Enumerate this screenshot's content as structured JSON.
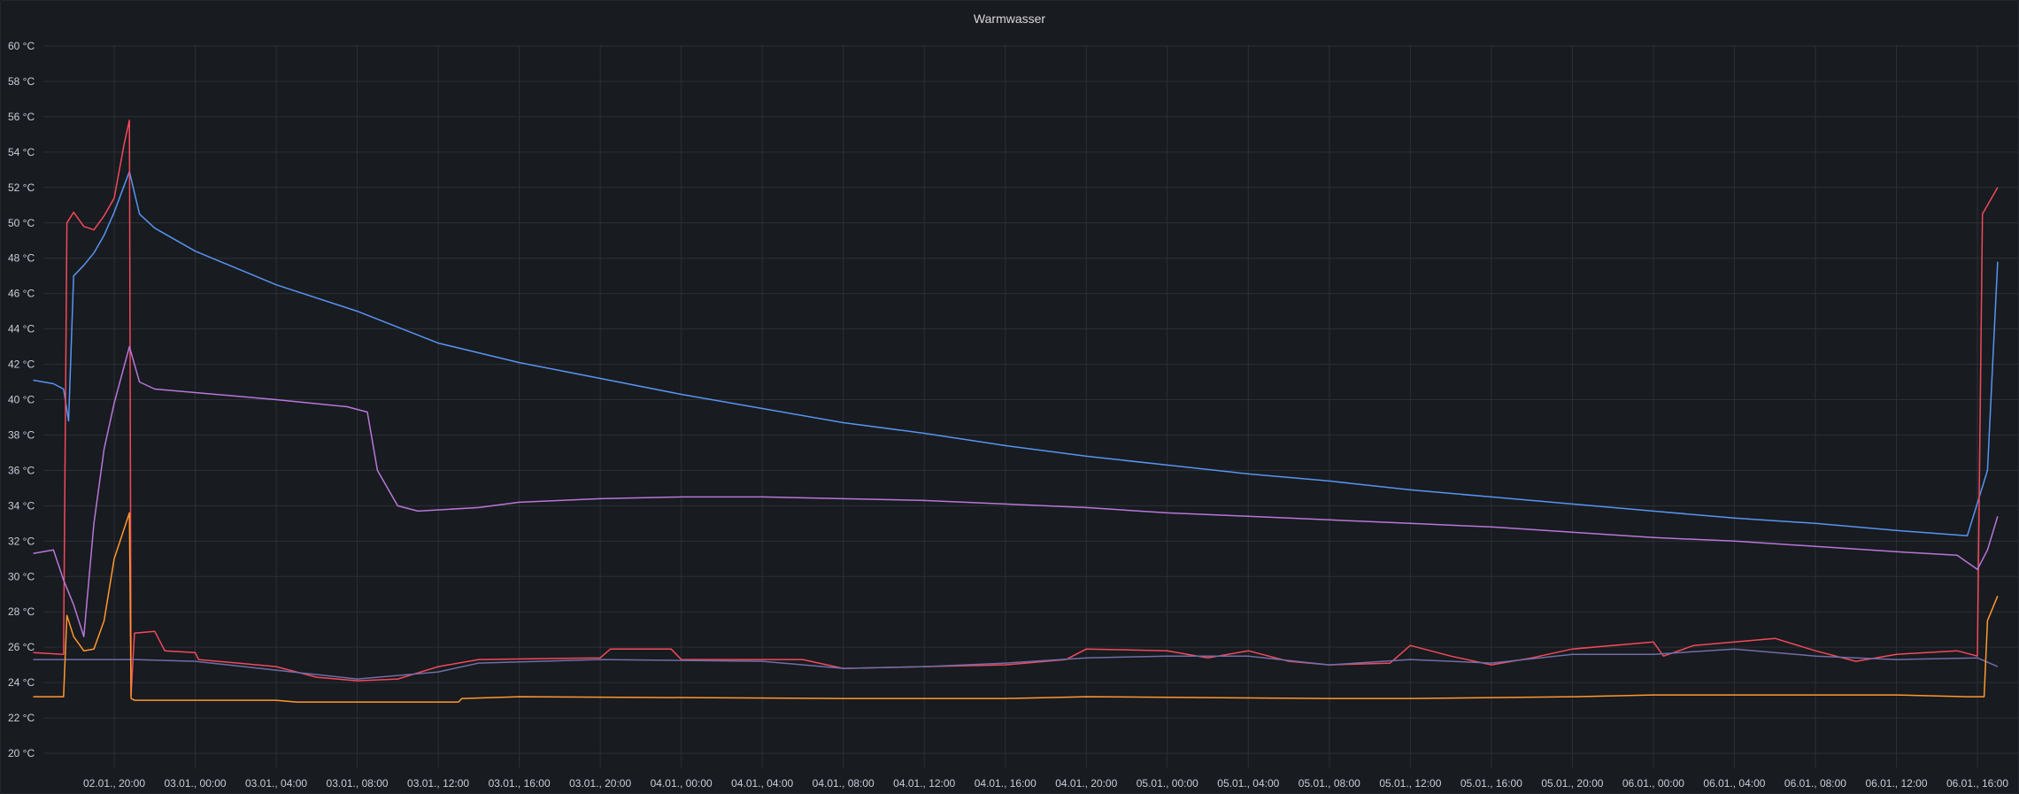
{
  "panel": {
    "title": "Warmwasser"
  },
  "chart_data": {
    "type": "line",
    "title": "Warmwasser",
    "xlabel": "",
    "ylabel": "",
    "unit": "°C",
    "ylim": [
      19.2,
      60
    ],
    "y_ticks": [
      "20 °C",
      "22 °C",
      "24 °C",
      "26 °C",
      "28 °C",
      "30 °C",
      "32 °C",
      "34 °C",
      "36 °C",
      "38 °C",
      "40 °C",
      "42 °C",
      "44 °C",
      "46 °C",
      "48 °C",
      "50 °C",
      "52 °C",
      "54 °C",
      "56 °C",
      "58 °C",
      "60 °C"
    ],
    "y_tick_values": [
      20,
      22,
      24,
      26,
      28,
      30,
      32,
      34,
      36,
      38,
      40,
      42,
      44,
      46,
      48,
      50,
      52,
      54,
      56,
      58,
      60
    ],
    "x_range": [
      "01.01., 14:00",
      "06.01., 17:00"
    ],
    "x_ticks": [
      {
        "t": "2024-01-02T20:00",
        "label": "02.01., 20:00"
      },
      {
        "t": "2024-01-03T00:00",
        "label": "03.01., 00:00"
      },
      {
        "t": "2024-01-03T04:00",
        "label": "03.01., 04:00"
      },
      {
        "t": "2024-01-03T08:00",
        "label": "03.01., 08:00"
      },
      {
        "t": "2024-01-03T12:00",
        "label": "03.01., 12:00"
      },
      {
        "t": "2024-01-03T16:00",
        "label": "03.01., 16:00"
      },
      {
        "t": "2024-01-03T20:00",
        "label": "03.01., 20:00"
      },
      {
        "t": "2024-01-04T00:00",
        "label": "04.01., 00:00"
      },
      {
        "t": "2024-01-04T04:00",
        "label": "04.01., 04:00"
      },
      {
        "t": "2024-01-04T08:00",
        "label": "04.01., 08:00"
      },
      {
        "t": "2024-01-04T12:00",
        "label": "04.01., 12:00"
      },
      {
        "t": "2024-01-04T16:00",
        "label": "04.01., 16:00"
      },
      {
        "t": "2024-01-04T20:00",
        "label": "04.01., 20:00"
      },
      {
        "t": "2024-01-05T00:00",
        "label": "05.01., 00:00"
      },
      {
        "t": "2024-01-05T04:00",
        "label": "05.01., 04:00"
      },
      {
        "t": "2024-01-05T08:00",
        "label": "05.01., 08:00"
      },
      {
        "t": "2024-01-05T12:00",
        "label": "05.01., 12:00"
      },
      {
        "t": "2024-01-05T16:00",
        "label": "05.01., 16:00"
      },
      {
        "t": "2024-01-05T20:00",
        "label": "05.01., 20:00"
      },
      {
        "t": "2024-01-06T00:00",
        "label": "06.01., 00:00"
      },
      {
        "t": "2024-01-06T04:00",
        "label": "06.01., 04:00"
      },
      {
        "t": "2024-01-06T08:00",
        "label": "06.01., 08:00"
      },
      {
        "t": "2024-01-06T12:00",
        "label": "06.01., 12:00"
      },
      {
        "t": "2024-01-06T16:00",
        "label": "06.01., 16:00"
      }
    ],
    "grid": true,
    "legend": "none",
    "series": [
      {
        "color": "#5794f2",
        "points": [
          [
            "2024-01-02T16:00",
            41.1
          ],
          [
            "2024-01-02T17:00",
            40.9
          ],
          [
            "2024-01-02T17:30",
            40.6
          ],
          [
            "2024-01-02T17:45",
            38.8
          ],
          [
            "2024-01-02T18:00",
            47.0
          ],
          [
            "2024-01-02T18:30",
            47.6
          ],
          [
            "2024-01-02T19:00",
            48.3
          ],
          [
            "2024-01-02T19:30",
            49.3
          ],
          [
            "2024-01-02T20:00",
            50.6
          ],
          [
            "2024-01-02T20:45",
            52.9
          ],
          [
            "2024-01-02T21:15",
            50.5
          ],
          [
            "2024-01-02T22:00",
            49.7
          ],
          [
            "2024-01-03T00:00",
            48.4
          ],
          [
            "2024-01-03T04:00",
            46.5
          ],
          [
            "2024-01-03T08:00",
            45.0
          ],
          [
            "2024-01-03T12:00",
            43.2
          ],
          [
            "2024-01-03T16:00",
            42.1
          ],
          [
            "2024-01-03T20:00",
            41.2
          ],
          [
            "2024-01-04T00:00",
            40.3
          ],
          [
            "2024-01-04T04:00",
            39.5
          ],
          [
            "2024-01-04T08:00",
            38.7
          ],
          [
            "2024-01-04T12:00",
            38.1
          ],
          [
            "2024-01-04T16:00",
            37.4
          ],
          [
            "2024-01-04T20:00",
            36.8
          ],
          [
            "2024-01-05T00:00",
            36.3
          ],
          [
            "2024-01-05T04:00",
            35.8
          ],
          [
            "2024-01-05T08:00",
            35.4
          ],
          [
            "2024-01-05T12:00",
            34.9
          ],
          [
            "2024-01-05T16:00",
            34.5
          ],
          [
            "2024-01-05T20:00",
            34.1
          ],
          [
            "2024-01-06T00:00",
            33.7
          ],
          [
            "2024-01-06T04:00",
            33.3
          ],
          [
            "2024-01-06T08:00",
            33.0
          ],
          [
            "2024-01-06T12:00",
            32.6
          ],
          [
            "2024-01-06T15:30",
            32.3
          ],
          [
            "2024-01-06T16:30",
            36.0
          ],
          [
            "2024-01-06T17:00",
            47.8
          ]
        ]
      },
      {
        "color": "#f2495c",
        "points": [
          [
            "2024-01-02T16:00",
            25.7
          ],
          [
            "2024-01-02T17:30",
            25.6
          ],
          [
            "2024-01-02T17:40",
            50.0
          ],
          [
            "2024-01-02T18:00",
            50.6
          ],
          [
            "2024-01-02T18:30",
            49.8
          ],
          [
            "2024-01-02T19:00",
            49.6
          ],
          [
            "2024-01-02T19:30",
            50.4
          ],
          [
            "2024-01-02T20:00",
            51.4
          ],
          [
            "2024-01-02T20:30",
            54.5
          ],
          [
            "2024-01-02T20:45",
            55.8
          ],
          [
            "2024-01-02T20:50",
            23.3
          ],
          [
            "2024-01-02T21:00",
            26.8
          ],
          [
            "2024-01-02T22:00",
            26.9
          ],
          [
            "2024-01-02T22:30",
            25.8
          ],
          [
            "2024-01-03T00:00",
            25.7
          ],
          [
            "2024-01-03T00:10",
            25.3
          ],
          [
            "2024-01-03T04:00",
            24.9
          ],
          [
            "2024-01-03T06:00",
            24.3
          ],
          [
            "2024-01-03T08:00",
            24.1
          ],
          [
            "2024-01-03T10:00",
            24.2
          ],
          [
            "2024-01-03T12:00",
            24.9
          ],
          [
            "2024-01-03T14:00",
            25.3
          ],
          [
            "2024-01-03T20:00",
            25.4
          ],
          [
            "2024-01-03T20:30",
            25.9
          ],
          [
            "2024-01-03T23:30",
            25.9
          ],
          [
            "2024-01-04T00:00",
            25.3
          ],
          [
            "2024-01-04T06:00",
            25.3
          ],
          [
            "2024-01-04T08:00",
            24.8
          ],
          [
            "2024-01-04T12:00",
            24.9
          ],
          [
            "2024-01-04T16:00",
            25.0
          ],
          [
            "2024-01-04T19:00",
            25.3
          ],
          [
            "2024-01-04T20:00",
            25.9
          ],
          [
            "2024-01-05T00:00",
            25.8
          ],
          [
            "2024-01-05T02:00",
            25.4
          ],
          [
            "2024-01-05T04:00",
            25.8
          ],
          [
            "2024-01-05T06:00",
            25.2
          ],
          [
            "2024-01-05T08:00",
            25.0
          ],
          [
            "2024-01-05T11:00",
            25.1
          ],
          [
            "2024-01-05T12:00",
            26.1
          ],
          [
            "2024-01-05T14:00",
            25.5
          ],
          [
            "2024-01-05T16:00",
            25.0
          ],
          [
            "2024-01-05T18:00",
            25.4
          ],
          [
            "2024-01-05T20:00",
            25.9
          ],
          [
            "2024-01-06T00:00",
            26.3
          ],
          [
            "2024-01-06T00:30",
            25.5
          ],
          [
            "2024-01-06T02:00",
            26.1
          ],
          [
            "2024-01-06T06:00",
            26.5
          ],
          [
            "2024-01-06T08:00",
            25.8
          ],
          [
            "2024-01-06T10:00",
            25.2
          ],
          [
            "2024-01-06T12:00",
            25.6
          ],
          [
            "2024-01-06T15:00",
            25.8
          ],
          [
            "2024-01-06T16:00",
            25.5
          ],
          [
            "2024-01-06T16:15",
            50.5
          ],
          [
            "2024-01-06T17:00",
            52.0
          ]
        ]
      },
      {
        "color": "#b877d9",
        "points": [
          [
            "2024-01-02T16:00",
            31.3
          ],
          [
            "2024-01-02T17:00",
            31.5
          ],
          [
            "2024-01-02T17:30",
            29.8
          ],
          [
            "2024-01-02T18:00",
            28.4
          ],
          [
            "2024-01-02T18:30",
            26.6
          ],
          [
            "2024-01-02T19:00",
            33.0
          ],
          [
            "2024-01-02T19:30",
            37.2
          ],
          [
            "2024-01-02T20:00",
            39.8
          ],
          [
            "2024-01-02T20:45",
            43.0
          ],
          [
            "2024-01-02T21:15",
            41.0
          ],
          [
            "2024-01-02T22:00",
            40.6
          ],
          [
            "2024-01-03T00:00",
            40.4
          ],
          [
            "2024-01-03T04:00",
            40.0
          ],
          [
            "2024-01-03T07:30",
            39.6
          ],
          [
            "2024-01-03T08:30",
            39.3
          ],
          [
            "2024-01-03T09:00",
            36.0
          ],
          [
            "2024-01-03T10:00",
            34.0
          ],
          [
            "2024-01-03T11:00",
            33.7
          ],
          [
            "2024-01-03T14:00",
            33.9
          ],
          [
            "2024-01-03T16:00",
            34.2
          ],
          [
            "2024-01-03T20:00",
            34.4
          ],
          [
            "2024-01-04T00:00",
            34.5
          ],
          [
            "2024-01-04T04:00",
            34.5
          ],
          [
            "2024-01-04T08:00",
            34.4
          ],
          [
            "2024-01-04T12:00",
            34.3
          ],
          [
            "2024-01-04T16:00",
            34.1
          ],
          [
            "2024-01-04T20:00",
            33.9
          ],
          [
            "2024-01-05T00:00",
            33.6
          ],
          [
            "2024-01-05T04:00",
            33.4
          ],
          [
            "2024-01-05T08:00",
            33.2
          ],
          [
            "2024-01-05T12:00",
            33.0
          ],
          [
            "2024-01-05T16:00",
            32.8
          ],
          [
            "2024-01-05T20:00",
            32.5
          ],
          [
            "2024-01-06T00:00",
            32.2
          ],
          [
            "2024-01-06T04:00",
            32.0
          ],
          [
            "2024-01-06T08:00",
            31.7
          ],
          [
            "2024-01-06T12:00",
            31.4
          ],
          [
            "2024-01-06T15:00",
            31.2
          ],
          [
            "2024-01-06T16:00",
            30.4
          ],
          [
            "2024-01-06T16:30",
            31.5
          ],
          [
            "2024-01-06T17:00",
            33.4
          ]
        ]
      },
      {
        "color": "#6e6ea8",
        "points": [
          [
            "2024-01-02T16:00",
            25.3
          ],
          [
            "2024-01-02T21:00",
            25.3
          ],
          [
            "2024-01-03T00:00",
            25.2
          ],
          [
            "2024-01-03T04:00",
            24.7
          ],
          [
            "2024-01-03T08:00",
            24.2
          ],
          [
            "2024-01-03T12:00",
            24.6
          ],
          [
            "2024-01-03T14:00",
            25.1
          ],
          [
            "2024-01-03T20:00",
            25.3
          ],
          [
            "2024-01-04T04:00",
            25.2
          ],
          [
            "2024-01-04T08:00",
            24.8
          ],
          [
            "2024-01-04T12:00",
            24.9
          ],
          [
            "2024-01-04T16:00",
            25.1
          ],
          [
            "2024-01-04T20:00",
            25.4
          ],
          [
            "2024-01-05T00:00",
            25.5
          ],
          [
            "2024-01-05T04:00",
            25.5
          ],
          [
            "2024-01-05T08:00",
            25.0
          ],
          [
            "2024-01-05T12:00",
            25.3
          ],
          [
            "2024-01-05T16:00",
            25.1
          ],
          [
            "2024-01-05T20:00",
            25.6
          ],
          [
            "2024-01-06T00:00",
            25.6
          ],
          [
            "2024-01-06T04:00",
            25.9
          ],
          [
            "2024-01-06T08:00",
            25.5
          ],
          [
            "2024-01-06T12:00",
            25.3
          ],
          [
            "2024-01-06T16:00",
            25.4
          ],
          [
            "2024-01-06T17:00",
            24.9
          ]
        ]
      },
      {
        "color": "#ff9830",
        "points": [
          [
            "2024-01-02T16:00",
            23.2
          ],
          [
            "2024-01-02T17:30",
            23.2
          ],
          [
            "2024-01-02T17:40",
            27.8
          ],
          [
            "2024-01-02T18:00",
            26.6
          ],
          [
            "2024-01-02T18:30",
            25.8
          ],
          [
            "2024-01-02T19:00",
            25.9
          ],
          [
            "2024-01-02T19:30",
            27.5
          ],
          [
            "2024-01-02T20:00",
            31.0
          ],
          [
            "2024-01-02T20:45",
            33.6
          ],
          [
            "2024-01-02T20:50",
            23.1
          ],
          [
            "2024-01-02T21:00",
            23.0
          ],
          [
            "2024-01-03T04:00",
            23.0
          ],
          [
            "2024-01-03T05:00",
            22.9
          ],
          [
            "2024-01-03T08:00",
            22.9
          ],
          [
            "2024-01-03T13:00",
            22.9
          ],
          [
            "2024-01-03T13:10",
            23.1
          ],
          [
            "2024-01-03T16:00",
            23.2
          ],
          [
            "2024-01-04T08:00",
            23.1
          ],
          [
            "2024-01-04T16:00",
            23.1
          ],
          [
            "2024-01-04T20:00",
            23.2
          ],
          [
            "2024-01-05T08:00",
            23.1
          ],
          [
            "2024-01-05T12:00",
            23.1
          ],
          [
            "2024-01-05T20:00",
            23.2
          ],
          [
            "2024-01-06T00:00",
            23.3
          ],
          [
            "2024-01-06T12:00",
            23.3
          ],
          [
            "2024-01-06T15:30",
            23.2
          ],
          [
            "2024-01-06T16:20",
            23.2
          ],
          [
            "2024-01-06T16:30",
            27.5
          ],
          [
            "2024-01-06T17:00",
            28.9
          ]
        ]
      }
    ]
  }
}
